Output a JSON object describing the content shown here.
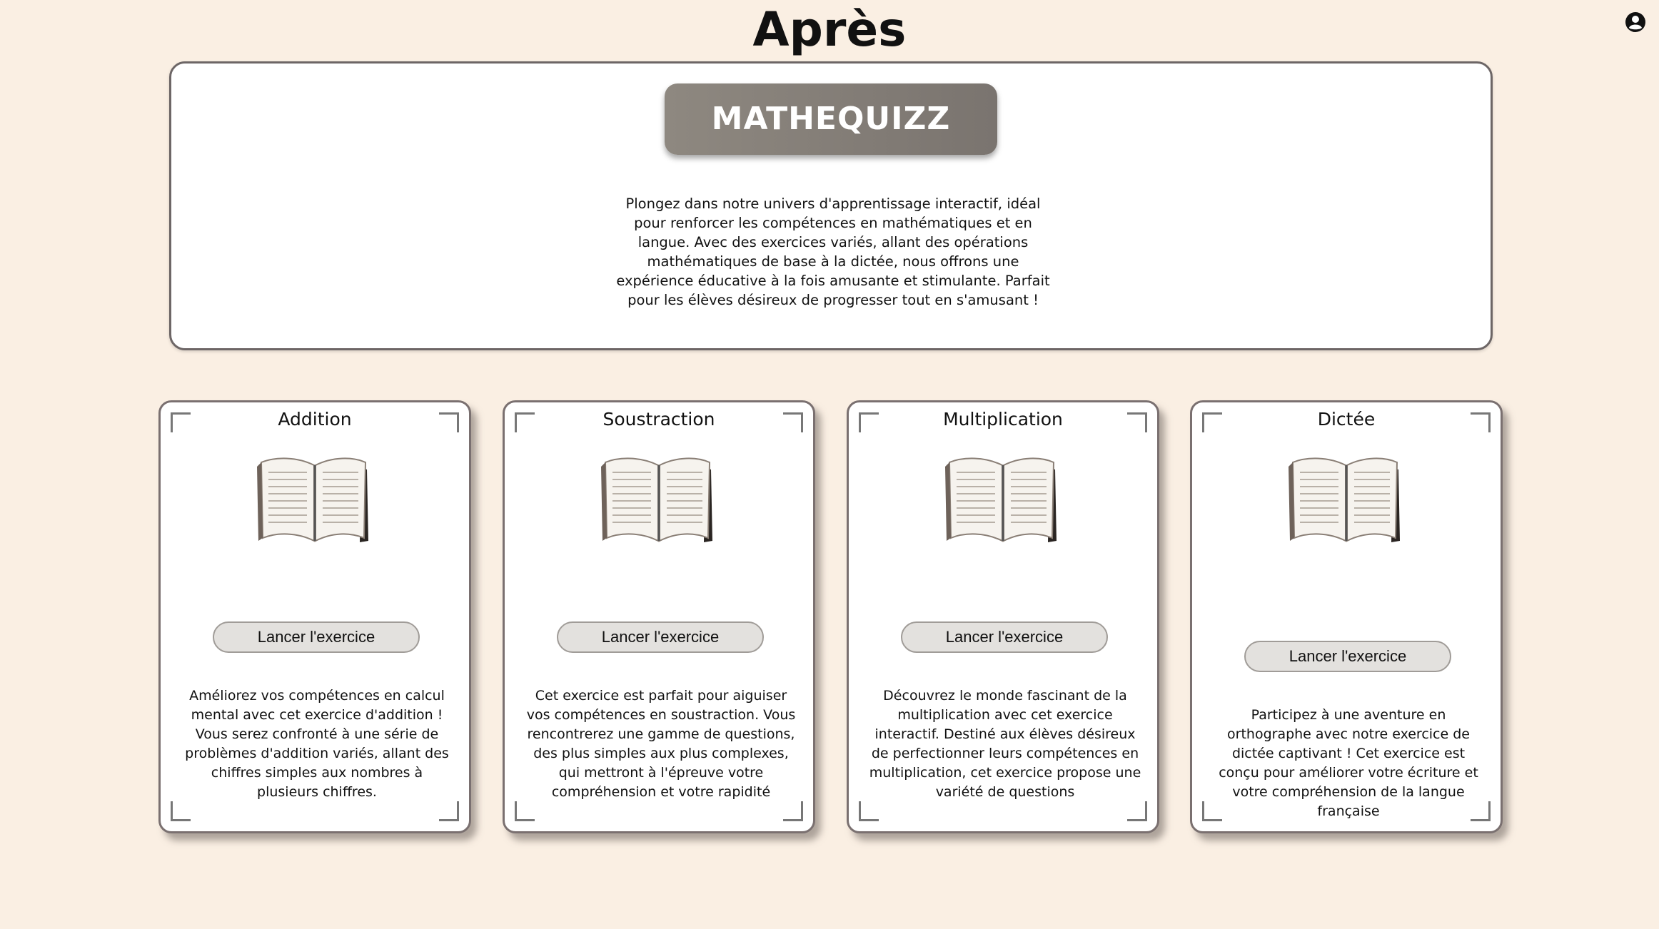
{
  "header": {
    "title": "Après",
    "user_icon": "user-circle-icon"
  },
  "hero": {
    "button_label": "MATHEQUIZZ",
    "description": "Plongez dans notre univers d'apprentissage interactif, idéal pour renforcer les compétences en mathématiques et en langue. Avec des exercices variés, allant des opérations mathématiques de base à la dictée, nous offrons une expérience éducative à la fois amusante et stimulante. Parfait pour les élèves désireux de progresser tout en s'amusant !"
  },
  "cards": [
    {
      "title": "Addition",
      "icon": "open-book-icon",
      "button_label": "Lancer l'exercice",
      "description": "Améliorez vos compétences en calcul mental avec cet exercice d'addition ! Vous serez confronté à une série de problèmes d'addition variés, allant des chiffres simples aux nombres à plusieurs chiffres."
    },
    {
      "title": "Soustraction",
      "icon": "open-book-icon",
      "button_label": "Lancer l'exercice",
      "description": "Cet exercice est parfait pour aiguiser vos compétences en soustraction. Vous rencontrerez une gamme de questions, des plus simples aux plus complexes, qui mettront à l'épreuve votre compréhension et votre rapidité"
    },
    {
      "title": "Multiplication",
      "icon": "open-book-icon",
      "button_label": "Lancer l'exercice",
      "description": "Découvrez le monde fascinant de la multiplication avec cet exercice interactif. Destiné aux élèves désireux de perfectionner leurs compétences en multiplication, cet exercice propose une variété de questions"
    },
    {
      "title": "Dictée",
      "icon": "open-book-icon",
      "button_label": "Lancer l'exercice",
      "description": "Participez à une aventure en orthographe avec notre exercice de dictée captivant ! Cet exercice est conçu pour améliorer votre écriture et votre compréhension de la langue française"
    }
  ],
  "colors": {
    "background": "#faefe3",
    "hero_button": "#857f79",
    "launch_button": "#e3e1de",
    "border": "#6d6666"
  }
}
